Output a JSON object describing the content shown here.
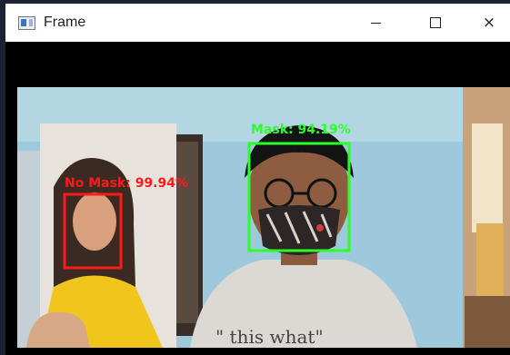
{
  "window": {
    "title": "Frame",
    "controls": {
      "minimize": "minimize",
      "maximize": "maximize",
      "close": "×"
    }
  },
  "detections": [
    {
      "label": "No Mask: 99.94%",
      "color": "#ff1a1a"
    },
    {
      "label": "Mask: 94.19%",
      "color": "#2bff2b"
    }
  ],
  "shirt_text": "\"  this what\""
}
